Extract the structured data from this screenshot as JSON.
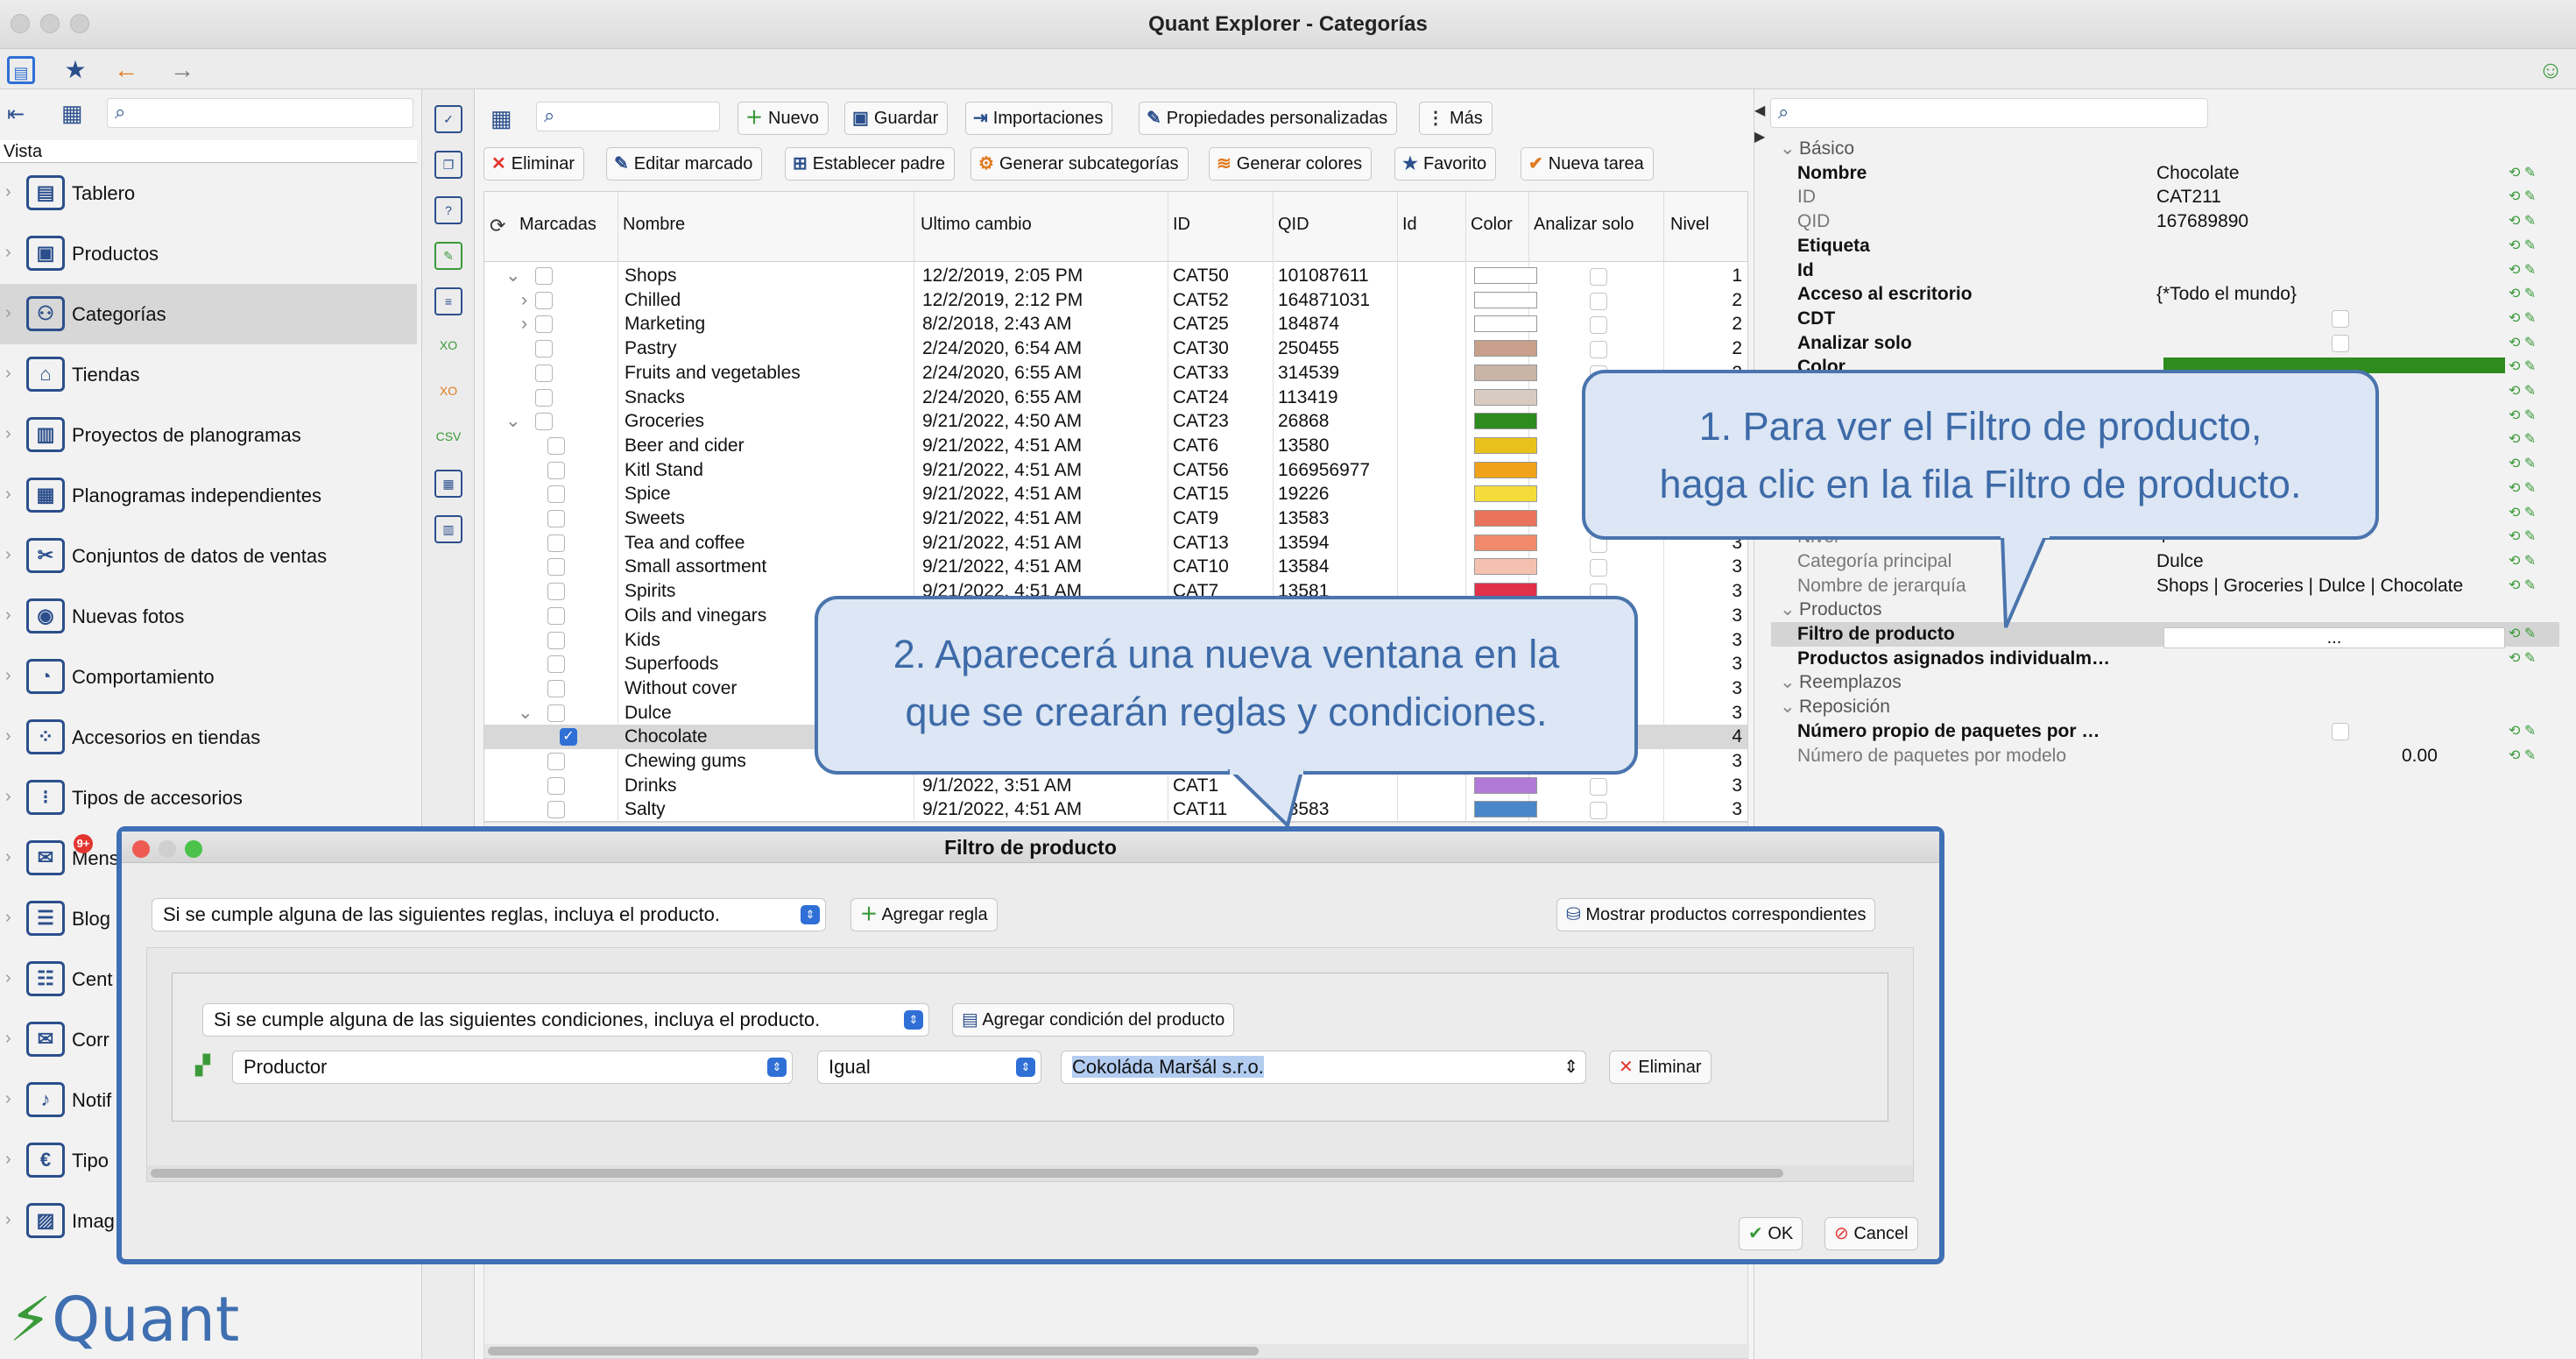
{
  "window": {
    "title": "Quant Explorer - Categorías"
  },
  "left": {
    "vista_label": "Vista",
    "nav": [
      {
        "label": "Tablero",
        "icon": "dashboard-icon"
      },
      {
        "label": "Productos",
        "icon": "products-icon"
      },
      {
        "label": "Categorías",
        "icon": "categories-icon"
      },
      {
        "label": "Tiendas",
        "icon": "stores-icon"
      },
      {
        "label": "Proyectos de planogramas",
        "icon": "planogram-projects-icon"
      },
      {
        "label": "Planogramas independientes",
        "icon": "planograms-icon"
      },
      {
        "label": "Conjuntos de datos de ventas",
        "icon": "sales-data-icon"
      },
      {
        "label": "Nuevas fotos",
        "icon": "camera-icon"
      },
      {
        "label": "Comportamiento",
        "icon": "behavior-icon"
      },
      {
        "label": "Accesorios en tiendas",
        "icon": "store-accessories-icon"
      },
      {
        "label": "Tipos de accesorios",
        "icon": "accessory-types-icon"
      },
      {
        "label": "Mens",
        "icon": "messages-icon",
        "badge": "9+"
      },
      {
        "label": "Blog",
        "icon": "blog-icon"
      },
      {
        "label": "Cent",
        "icon": "center-icon"
      },
      {
        "label": "Corr",
        "icon": "mail-icon"
      },
      {
        "label": "Notif",
        "icon": "notifications-icon"
      },
      {
        "label": "Tipo",
        "icon": "types-icon"
      },
      {
        "label": "Imag",
        "icon": "images-icon"
      }
    ],
    "logo": "Quant"
  },
  "toolbar": {
    "row1": [
      "Nuevo",
      "Guardar",
      "Importaciones",
      "Propiedades personalizadas",
      "Más"
    ],
    "row2": [
      "Eliminar",
      "Editar marcado",
      "Establecer padre",
      "Generar subcategorías",
      "Generar colores",
      "Favorito",
      "Nueva tarea"
    ]
  },
  "grid": {
    "headers": [
      "Marcadas",
      "Nombre",
      "Ultimo cambio",
      "ID",
      "QID",
      "Id",
      "Color",
      "Analizar solo",
      "Nivel"
    ],
    "rows": [
      {
        "name": "Shops",
        "changed": "12/2/2019, 2:05 PM",
        "id": "CAT50",
        "qid": "101087611",
        "color": "#ffffff",
        "level": "1"
      },
      {
        "name": "Chilled",
        "changed": "12/2/2019, 2:12 PM",
        "id": "CAT52",
        "qid": "164871031",
        "color": "#ffffff",
        "level": "2"
      },
      {
        "name": "Marketing",
        "changed": "8/2/2018, 2:43 AM",
        "id": "CAT25",
        "qid": "184874",
        "color": "#ffffff",
        "level": "2"
      },
      {
        "name": "Pastry",
        "changed": "2/24/2020, 6:54 AM",
        "id": "CAT30",
        "qid": "250455",
        "color": "#c8a08c",
        "level": "2"
      },
      {
        "name": "Fruits and vegetables",
        "changed": "2/24/2020, 6:55 AM",
        "id": "CAT33",
        "qid": "314539",
        "color": "#c9b4a6",
        "level": "2"
      },
      {
        "name": "Snacks",
        "changed": "2/24/2020, 6:55 AM",
        "id": "CAT24",
        "qid": "113419",
        "color": "#d8cbc2",
        "level": "2"
      },
      {
        "name": "Groceries",
        "changed": "9/21/2022, 4:50 AM",
        "id": "CAT23",
        "qid": "26868",
        "color": "#2e8b1e",
        "level": "2"
      },
      {
        "name": "Beer and cider",
        "changed": "9/21/2022, 4:51 AM",
        "id": "CAT6",
        "qid": "13580",
        "color": "#e8c21a",
        "level": "3"
      },
      {
        "name": "Kitl Stand",
        "changed": "9/21/2022, 4:51 AM",
        "id": "CAT56",
        "qid": "166956977",
        "color": "#f0a21a",
        "level": "3"
      },
      {
        "name": "Spice",
        "changed": "9/21/2022, 4:51 AM",
        "id": "CAT15",
        "qid": "19226",
        "color": "#f5dc3a",
        "level": "3"
      },
      {
        "name": "Sweets",
        "changed": "9/21/2022, 4:51 AM",
        "id": "CAT9",
        "qid": "13583",
        "color": "#e8735a",
        "level": "3"
      },
      {
        "name": "Tea and coffee",
        "changed": "9/21/2022, 4:51 AM",
        "id": "CAT13",
        "qid": "13594",
        "color": "#f08a6a",
        "level": "3"
      },
      {
        "name": "Small assortment",
        "changed": "9/21/2022, 4:51 AM",
        "id": "CAT10",
        "qid": "13584",
        "color": "#f4c1b0",
        "level": "3"
      },
      {
        "name": "Spirits",
        "changed": "9/21/2022, 4:51 AM",
        "id": "CAT7",
        "qid": "13581",
        "color": "#e0304a",
        "level": "3"
      },
      {
        "name": "Oils and vinegars",
        "changed": "",
        "id": "",
        "qid": "",
        "color": "",
        "level": "3"
      },
      {
        "name": "Kids",
        "changed": "",
        "id": "",
        "qid": "",
        "color": "",
        "level": "3"
      },
      {
        "name": "Superfoods",
        "changed": "",
        "id": "",
        "qid": "",
        "color": "",
        "level": "3"
      },
      {
        "name": "Without cover",
        "changed": "",
        "id": "",
        "qid": "",
        "color": "",
        "level": "3"
      },
      {
        "name": "Dulce",
        "changed": "",
        "id": "",
        "qid": "",
        "color": "",
        "level": "3"
      },
      {
        "name": "Chocolate",
        "changed": "",
        "id": "",
        "qid": "",
        "color": "",
        "level": "4",
        "checked": true,
        "selected": true
      },
      {
        "name": "Chewing gums",
        "changed": "",
        "id": "",
        "qid": "",
        "color": "",
        "level": "3"
      },
      {
        "name": "Drinks",
        "changed": "9/1/2022, 3:51 AM",
        "id": "CAT1",
        "qid": "1",
        "color": "#b07ad6",
        "level": "3"
      },
      {
        "name": "Salty",
        "changed": "9/21/2022, 4:51 AM",
        "id": "CAT11",
        "qid": "13583",
        "color": "#4a86c8",
        "level": "3"
      }
    ]
  },
  "props": {
    "rows": [
      {
        "k": "Básico",
        "v": "",
        "type": "section"
      },
      {
        "k": "Nombre",
        "v": "Chocolate",
        "type": "bold"
      },
      {
        "k": "ID",
        "v": "CAT211",
        "type": "gray"
      },
      {
        "k": "QID",
        "v": "167689890",
        "type": "gray"
      },
      {
        "k": "Etiqueta",
        "v": "",
        "type": "bold"
      },
      {
        "k": "Id",
        "v": "",
        "type": "bold"
      },
      {
        "k": "Acceso al escritorio",
        "v": "{*Todo el mundo}",
        "type": "bold"
      },
      {
        "k": "CDT",
        "v": "",
        "type": "bold"
      },
      {
        "k": "Analizar solo",
        "v": "",
        "type": "bold"
      },
      {
        "k": "Color",
        "v": "",
        "type": "bold"
      },
      {
        "k": "",
        "v": "",
        "type": "bold"
      },
      {
        "k": "",
        "v": "",
        "type": "bold"
      },
      {
        "k": "",
        "v": "",
        "type": "bold"
      },
      {
        "k": "",
        "v": "",
        "type": "bold"
      },
      {
        "k": "",
        "v": "",
        "type": "bold"
      },
      {
        "k": "",
        "v": "",
        "type": "bold"
      },
      {
        "k": "Nivel",
        "v": "4",
        "type": "gray"
      },
      {
        "k": "Categoría principal",
        "v": "Dulce",
        "type": "gray"
      },
      {
        "k": "Nombre de jerarquía",
        "v": "Shops | Groceries | Dulce | Chocolate",
        "type": "gray"
      },
      {
        "k": "Productos",
        "v": "",
        "type": "section"
      },
      {
        "k": "Filtro de producto",
        "v": "...",
        "type": "bold",
        "hl": true
      },
      {
        "k": "Productos asignados individualm…",
        "v": "",
        "type": "bold"
      },
      {
        "k": "Reemplazos",
        "v": "",
        "type": "section"
      },
      {
        "k": "Reposición",
        "v": "",
        "type": "section"
      },
      {
        "k": "Número propio de paquetes por …",
        "v": "",
        "type": "bold"
      },
      {
        "k": "Número de paquetes por modelo",
        "v": "0.00",
        "type": "gray"
      }
    ]
  },
  "callouts": {
    "one": [
      "1. Para ver el Filtro de producto,",
      "haga clic en la fila Filtro de producto."
    ],
    "two": [
      "2. Aparecerá una nueva ventana en la",
      "que se crearán reglas y condiciones."
    ]
  },
  "dialog": {
    "title": "Filtro de producto",
    "rule_mode": "Si se cumple alguna de las siguientes reglas, incluya el producto.",
    "add_rule": "Agregar regla",
    "show_products": "Mostrar productos correspondientes",
    "cond_mode": "Si se cumple alguna de las siguientes condiciones, incluya el producto.",
    "add_condition": "Agregar condición del producto",
    "field": "Productor",
    "operator": "Igual",
    "value": "Cokoláda Maršál s.r.o.",
    "delete": "Eliminar",
    "ok": "OK",
    "cancel": "Cancel"
  }
}
